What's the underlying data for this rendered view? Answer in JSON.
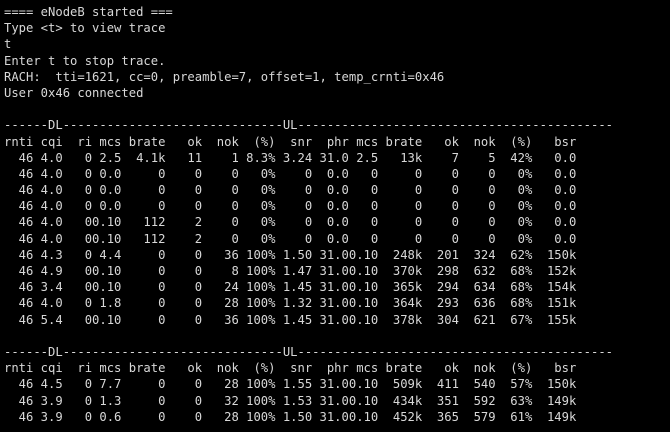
{
  "terminal": {
    "header_lines": [
      "==== eNodeB started ===",
      "Type <t> to view trace",
      "t",
      "Enter t to stop trace.",
      "RACH:  tti=1621, cc=0, preamble=7, offset=1, temp_crnti=0x46",
      "User 0x46 connected"
    ],
    "table1": {
      "separator": "------DL------------------------------UL-------------------------------------------",
      "header": "rnti cqi  ri mcs brate   ok  nok  (%)  snr  phr mcs brate   ok  nok  (%)   bsr",
      "rows": [
        "  46 4.0   0 2.5  4.1k   11    1 8.3% 3.24 31.0 2.5   13k    7    5  42%   0.0",
        "  46 4.0   0 0.0     0    0    0   0%    0  0.0   0     0    0    0   0%   0.0",
        "  46 4.0   0 0.0     0    0    0   0%    0  0.0   0     0    0    0   0%   0.0",
        "  46 4.0   0 0.0     0    0    0   0%    0  0.0   0     0    0    0   0%   0.0",
        "  46 4.0   00.10   112    2    0   0%    0  0.0   0     0    0    0   0%   0.0",
        "  46 4.0   00.10   112    2    0   0%    0  0.0   0     0    0    0   0%   0.0",
        "  46 4.3   0 4.4     0    0   36 100% 1.50 31.00.10  248k  201  324  62%  150k",
        "  46 4.9   00.10     0    0    8 100% 1.47 31.00.10  370k  298  632  68%  152k",
        "  46 3.4   00.10     0    0   24 100% 1.45 31.00.10  365k  294  634  68%  154k",
        "  46 4.0   0 1.8     0    0   28 100% 1.32 31.00.10  364k  293  636  68%  151k",
        "  46 5.4   00.10     0    0   36 100% 1.45 31.00.10  378k  304  621  67%  155k"
      ]
    },
    "table2": {
      "separator": "------DL------------------------------UL-------------------------------------------",
      "header": "rnti cqi  ri mcs brate   ok  nok  (%)  snr  phr mcs brate   ok  nok  (%)   bsr",
      "rows": [
        "  46 4.5   0 7.7     0    0   28 100% 1.55 31.00.10  509k  411  540  57%  150k",
        "  46 3.9   0 1.3     0    0   32 100% 1.53 31.00.10  434k  351  592  63%  149k",
        "  46 3.9   0 0.6     0    0   28 100% 1.50 31.00.10  452k  365  579  61%  149k"
      ]
    }
  },
  "colors": {
    "background": "#000000",
    "foreground": "#d8d8d8"
  }
}
